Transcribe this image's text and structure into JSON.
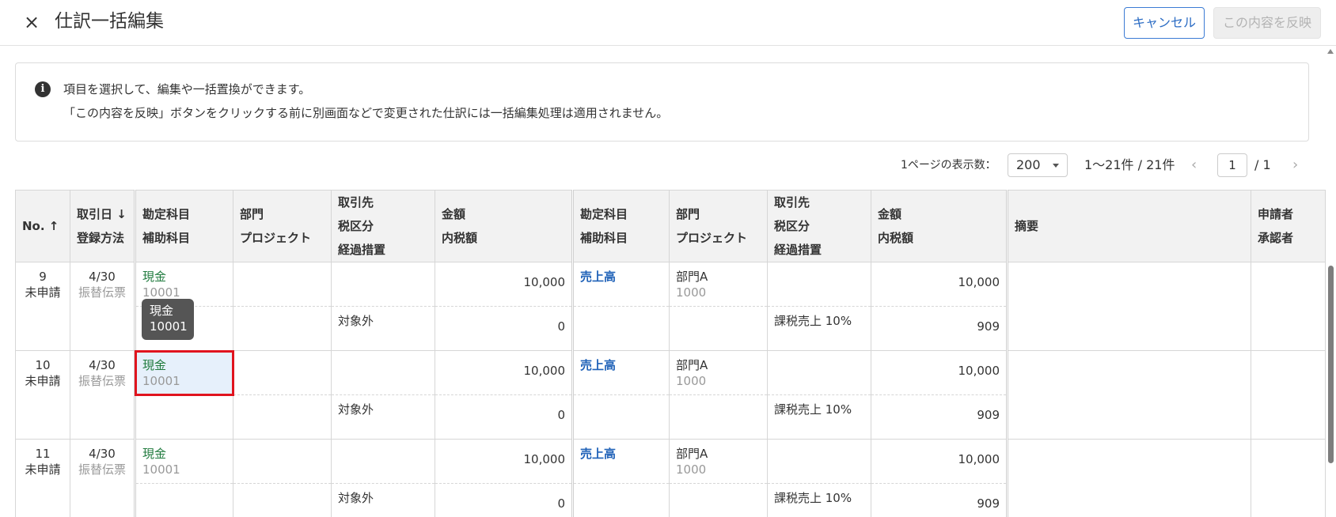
{
  "header": {
    "close_icon": "×",
    "title": "仕訳一括編集",
    "cancel_label": "キャンセル",
    "apply_label": "この内容を反映"
  },
  "info": {
    "icon": "i",
    "line1": "項目を選択して、編集や一括置換ができます。",
    "line2": "「この内容を反映」ボタンをクリックする前に別画面などで変更された仕訳には一括編集処理は適用されません。"
  },
  "pager": {
    "per_page_label": "1ページの表示数：",
    "per_page_value": "200",
    "range": "1〜21件 / 21件",
    "prev": "‹",
    "current_page": "1",
    "total_pages": "/ 1",
    "next": "›"
  },
  "columns": {
    "no": "No. ↑",
    "date": "取引日 ↓",
    "method": "登録方法",
    "debit_account": "勘定科目",
    "debit_sub": "補助科目",
    "debit_dept": "部門",
    "debit_project": "プロジェクト",
    "debit_partner": "取引先",
    "debit_tax": "税区分",
    "debit_transition": "経過措置",
    "debit_amount": "金額",
    "debit_tax_incl": "内税額",
    "credit_account": "勘定科目",
    "credit_sub": "補助科目",
    "credit_dept": "部門",
    "credit_project": "プロジェクト",
    "credit_partner": "取引先",
    "credit_tax": "税区分",
    "credit_transition": "経過措置",
    "credit_amount": "金額",
    "credit_tax_incl": "内税額",
    "memo": "摘要",
    "applicant": "申請者",
    "approver": "承認者"
  },
  "rows": [
    {
      "no": "9",
      "status": "未申請",
      "date": "4/30",
      "method": "振替伝票",
      "debit_account": "現金",
      "debit_code": "10001",
      "debit_amount": "10,000",
      "debit_tax": "対象外",
      "debit_tax_amount": "0",
      "credit_account": "売上高",
      "credit_dept": "部門A",
      "credit_dept_code": "1000",
      "credit_amount": "10,000",
      "credit_tax": "課税売上 10%",
      "credit_tax_amount": "909"
    },
    {
      "no": "10",
      "status": "未申請",
      "date": "4/30",
      "method": "振替伝票",
      "debit_account": "現金",
      "debit_code": "10001",
      "debit_amount": "10,000",
      "debit_tax": "対象外",
      "debit_tax_amount": "0",
      "credit_account": "売上高",
      "credit_dept": "部門A",
      "credit_dept_code": "1000",
      "credit_amount": "10,000",
      "credit_tax": "課税売上 10%",
      "credit_tax_amount": "909"
    },
    {
      "no": "11",
      "status": "未申請",
      "date": "4/30",
      "method": "振替伝票",
      "debit_account": "現金",
      "debit_code": "10001",
      "debit_amount": "10,000",
      "debit_tax": "対象外",
      "debit_tax_amount": "0",
      "credit_account": "売上高",
      "credit_dept": "部門A",
      "credit_dept_code": "1000",
      "credit_amount": "10,000",
      "credit_tax": "課税売上 10%",
      "credit_tax_amount": "909"
    }
  ],
  "tooltip": {
    "line1": "現金",
    "line2": "10001"
  }
}
